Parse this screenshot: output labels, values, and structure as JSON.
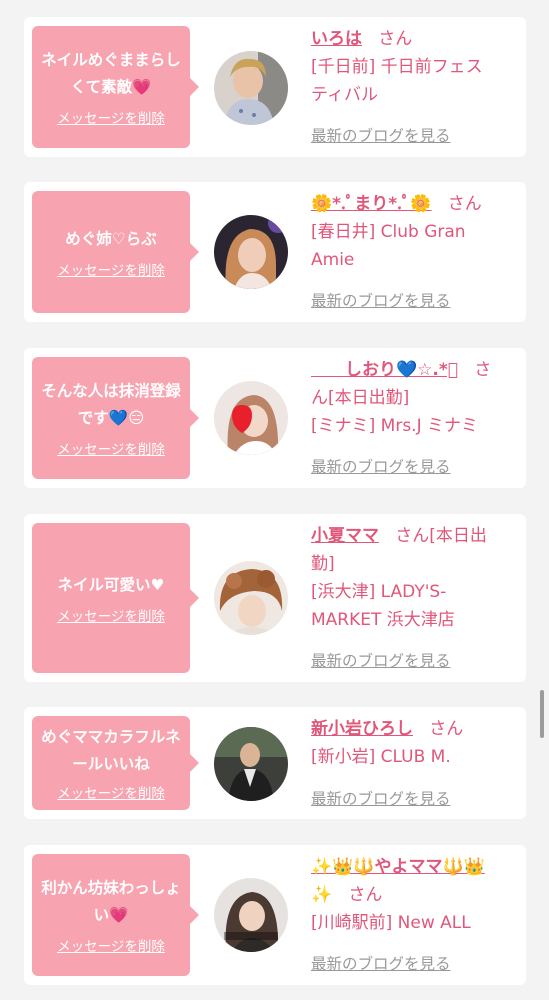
{
  "delete_label": "メッセージを削除",
  "blog_label": "最新のブログを見る",
  "san_label": "さん",
  "colors": {
    "accent": "#e0577a",
    "bubble": "#f7a3b0",
    "link_gray": "#999999",
    "background": "#f3f3f3"
  },
  "messages": [
    {
      "message": "ネイルめぐままらしくて素敵💗",
      "name": "いろは",
      "shop_line1": "[千日前] 千日前フェス",
      "shop_line2": "ティバル"
    },
    {
      "message": "めぐ姉♡らぶ",
      "name": "🌼*.ﾟまり*.ﾟ🌼",
      "shop_line1": "[春日井] Club Gran",
      "shop_line2": "Amie"
    },
    {
      "message": "そんな人は抹消登録です💙😑",
      "name": "　　しおり💙☆.*ﾟ",
      "san_suffix": "さ",
      "shop_line1": "ん[本日出勤]",
      "shop_line2": "[ミナミ] Mrs.J ミナミ"
    },
    {
      "message": "ネイル可愛い♥",
      "name": "小夏ママ",
      "san_suffix": "さん[本日出",
      "name_line2": "勤]",
      "shop_line1": "[浜大津] LADY'S-",
      "shop_line2": "MARKET 浜大津店"
    },
    {
      "message": "めぐママカラフルネールいいね",
      "name": "新小岩ひろし",
      "shop_line1": "[新小岩] CLUB M."
    },
    {
      "message": "利かん坊妹わっしょい💗",
      "name": "✨👑🔱やよママ🔱👑",
      "name_line2": "✨",
      "shop_line1": "[川崎駅前] New ALL"
    }
  ]
}
